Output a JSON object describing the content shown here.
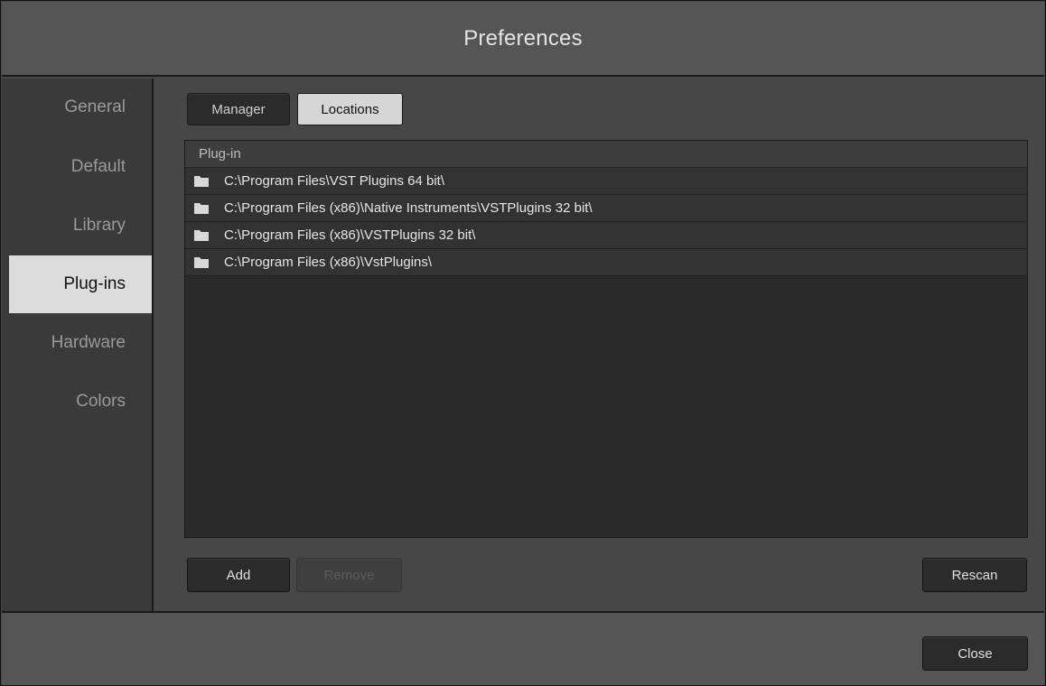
{
  "window": {
    "title": "Preferences"
  },
  "sidebar": {
    "items": [
      {
        "label": "General",
        "active": false
      },
      {
        "label": "Default",
        "active": false
      },
      {
        "label": "Library",
        "active": false
      },
      {
        "label": "Plug-ins",
        "active": true
      },
      {
        "label": "Hardware",
        "active": false
      },
      {
        "label": "Colors",
        "active": false
      }
    ]
  },
  "tabs": {
    "manager": "Manager",
    "locations": "Locations",
    "selected": "Locations"
  },
  "table": {
    "column_header": "Plug-in",
    "rows": [
      {
        "icon": "folder-icon",
        "path": "C:\\Program Files\\VST Plugins 64 bit\\"
      },
      {
        "icon": "folder-icon",
        "path": "C:\\Program Files (x86)\\Native Instruments\\VSTPlugins 32 bit\\"
      },
      {
        "icon": "folder-icon",
        "path": "C:\\Program Files (x86)\\VSTPlugins 32 bit\\"
      },
      {
        "icon": "folder-icon",
        "path": "C:\\Program Files (x86)\\VstPlugins\\"
      }
    ]
  },
  "actions": {
    "add": "Add",
    "remove": "Remove",
    "rescan": "Rescan"
  },
  "footer": {
    "close": "Close"
  },
  "colors": {
    "active_nav_bg": "#dcdcdc",
    "panel_bg": "#474747",
    "list_bg": "#2a2a2a"
  }
}
